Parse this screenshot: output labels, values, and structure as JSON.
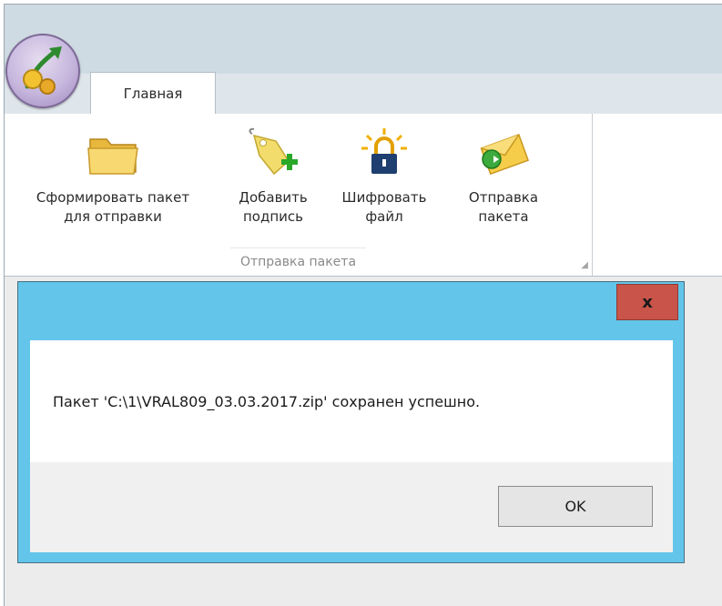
{
  "ribbon": {
    "tabs": [
      {
        "label": "Главная"
      }
    ],
    "group_label": "Отправка пакета",
    "buttons": [
      {
        "label_line1": "Сформировать пакет",
        "label_line2": "для отправки",
        "icon": "folder-icon"
      },
      {
        "label_line1": "Добавить",
        "label_line2": "подпись",
        "icon": "tag-add-icon"
      },
      {
        "label_line1": "Шифровать",
        "label_line2": "файл",
        "icon": "lock-icon"
      },
      {
        "label_line1": "Отправка",
        "label_line2": "пакета",
        "icon": "envelope-send-icon"
      }
    ]
  },
  "dialog": {
    "close_label": "x",
    "message": "Пакет 'C:\\1\\VRAL809_03.03.2017.zip' сохранен успешно.",
    "ok_label": "OK"
  },
  "colors": {
    "dialog_frame": "#62c5e9",
    "close_button": "#c8544a",
    "title_area": "#cfdbe2"
  }
}
